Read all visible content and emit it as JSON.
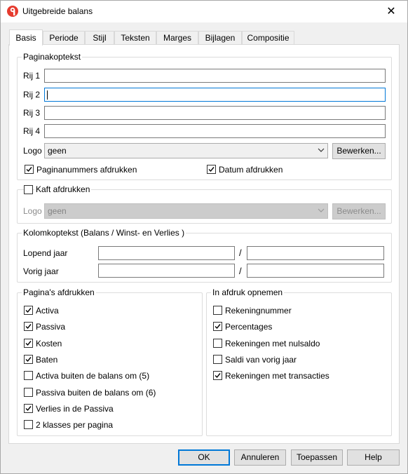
{
  "window": {
    "title": "Uitgebreide balans",
    "close": "✕"
  },
  "tabs": [
    "Basis",
    "Periode",
    "Stijl",
    "Teksten",
    "Marges",
    "Bijlagen",
    "Compositie"
  ],
  "header": {
    "title": "Paginakoptekst",
    "rows": [
      {
        "label": "Rij 1",
        "value": ""
      },
      {
        "label": "Rij 2",
        "value": ""
      },
      {
        "label": "Rij 3",
        "value": ""
      },
      {
        "label": "Rij 4",
        "value": ""
      }
    ],
    "logo_label": "Logo",
    "logo_value": "geen",
    "edit_label": "Bewerken...",
    "page_numbers": {
      "label": "Paginanummers afdrukken",
      "checked": true
    },
    "date": {
      "label": "Datum afdrukken",
      "checked": true
    }
  },
  "cover": {
    "label": "Kaft afdrukken",
    "checked": false,
    "logo_label": "Logo",
    "logo_value": "geen",
    "edit_label": "Bewerken..."
  },
  "columns": {
    "title": "Kolomkoptekst (Balans / Winst- en Verlies )",
    "current_label": "Lopend jaar",
    "previous_label": "Vorig jaar",
    "separator": "/"
  },
  "pages": {
    "title": "Pagina's afdrukken",
    "items": [
      {
        "label": "Activa",
        "checked": true
      },
      {
        "label": "Passiva",
        "checked": true
      },
      {
        "label": "Kosten",
        "checked": true
      },
      {
        "label": "Baten",
        "checked": true
      },
      {
        "label": "Activa buiten de balans om (5)",
        "checked": false
      },
      {
        "label": "Passiva buiten de balans om (6)",
        "checked": false
      },
      {
        "label": "Verlies in de Passiva",
        "checked": true
      },
      {
        "label": "2 klasses per pagina",
        "checked": false
      }
    ]
  },
  "include": {
    "title": "In afdruk opnemen",
    "items": [
      {
        "label": "Rekeningnummer",
        "checked": false
      },
      {
        "label": "Percentages",
        "checked": true
      },
      {
        "label": "Rekeningen met nulsaldo",
        "checked": false
      },
      {
        "label": "Saldi van vorig jaar",
        "checked": false
      },
      {
        "label": "Rekeningen met transacties",
        "checked": true
      }
    ]
  },
  "footer": {
    "ok": "OK",
    "cancel": "Annuleren",
    "apply": "Toepassen",
    "help": "Help"
  }
}
